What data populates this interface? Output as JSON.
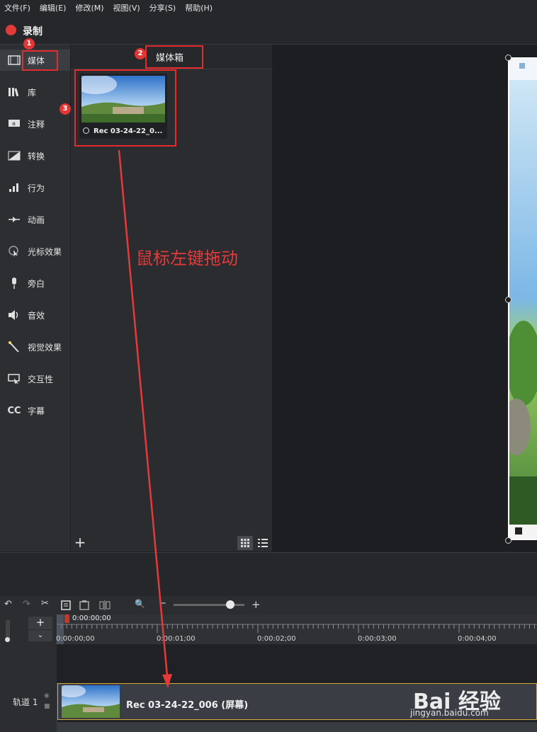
{
  "menu": [
    "文件(F)",
    "编辑(E)",
    "修改(M)",
    "视图(V)",
    "分享(S)",
    "帮助(H)"
  ],
  "record": {
    "label": "录制",
    "color": "#e23b3b"
  },
  "sidebar": {
    "items": [
      {
        "label": "媒体",
        "icon": "film-icon"
      },
      {
        "label": "库",
        "icon": "library-icon"
      },
      {
        "label": "注释",
        "icon": "annotation-icon"
      },
      {
        "label": "转换",
        "icon": "transition-icon"
      },
      {
        "label": "行为",
        "icon": "behavior-icon"
      },
      {
        "label": "动画",
        "icon": "animation-icon"
      },
      {
        "label": "光标效果",
        "icon": "cursor-effect-icon"
      },
      {
        "label": "旁白",
        "icon": "microphone-icon"
      },
      {
        "label": "音效",
        "icon": "speaker-icon"
      },
      {
        "label": "视觉效果",
        "icon": "magic-wand-icon"
      },
      {
        "label": "交互性",
        "icon": "interactive-icon"
      },
      {
        "label": "字幕",
        "icon": "cc-icon"
      }
    ]
  },
  "media_bin": {
    "title": "媒体箱",
    "item": {
      "name": "Rec 03-24-22_0..."
    }
  },
  "timeline": {
    "playhead_time": "0:00:00;00",
    "ticks": [
      "0:00:00;00",
      "0:00:01;00",
      "0:00:02;00",
      "0:00:03;00",
      "0:00:04;00"
    ],
    "track_label": "轨道 1",
    "clip_label": "Rec 03-24-22_006 (屏幕)"
  },
  "annotations": {
    "badges": [
      "1",
      "2",
      "3"
    ],
    "drag_text": "鼠标左键拖动",
    "color": "#e52b2b"
  },
  "watermark": {
    "brand": "Bai 经验",
    "url": "jingyan.baidu.com"
  },
  "colors": {
    "accent_clip_border": "#d8a93a",
    "panel_bg": "#2a2c30"
  }
}
